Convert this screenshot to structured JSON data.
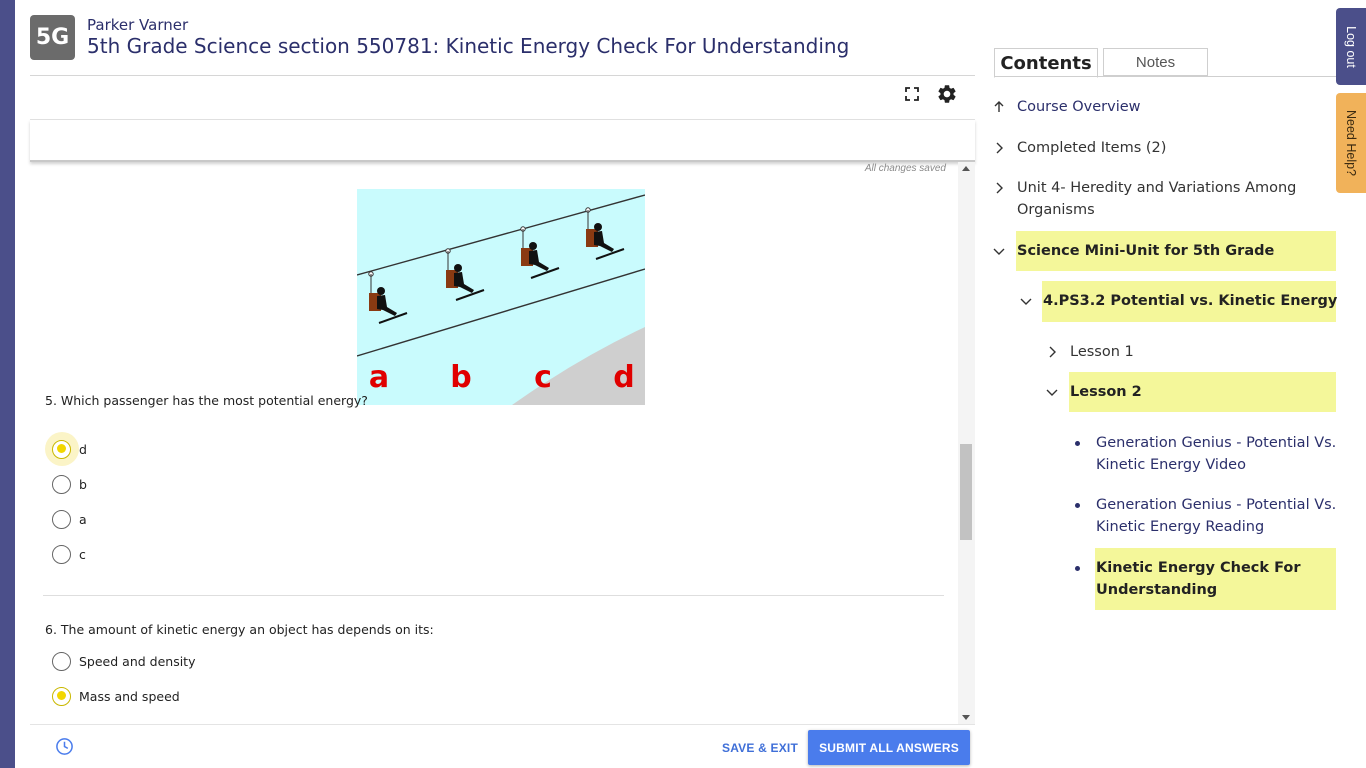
{
  "header": {
    "badge": "5G",
    "student_name": "Parker Varner",
    "title": "5th Grade Science section 550781: Kinetic Energy Check For Understanding"
  },
  "content": {
    "saved_status": "All changes saved",
    "questions": [
      {
        "text": "5. Which passenger has the most potential energy?",
        "image_letters": [
          "a",
          "b",
          "c",
          "d"
        ],
        "choices": [
          {
            "label": "d",
            "selected": true
          },
          {
            "label": "b",
            "selected": false
          },
          {
            "label": "a",
            "selected": false
          },
          {
            "label": "c",
            "selected": false
          }
        ]
      },
      {
        "text": "6. The amount of kinetic energy an object has depends on its:",
        "choices": [
          {
            "label": "Speed and density",
            "selected": false
          },
          {
            "label": "Mass and speed",
            "selected": true
          }
        ]
      }
    ]
  },
  "footer": {
    "save_exit": "SAVE & EXIT",
    "submit": "SUBMIT ALL ANSWERS"
  },
  "sidebar": {
    "tabs": [
      "Contents",
      "Notes"
    ],
    "active_tab": "Contents",
    "toc": {
      "course_overview": "Course Overview",
      "completed_items": "Completed Items (2)",
      "unit4_line1": "Unit 4- Heredity and Variations Among",
      "unit4_line2": "Organisms",
      "science_mini_unit": "Science Mini-Unit for 5th Grade",
      "ps32": "4.PS3.2 Potential vs. Kinetic Energy",
      "lesson1": "Lesson 1",
      "lesson2": "Lesson 2",
      "item1_line1": "Generation Genius - Potential Vs.",
      "item1_line2": "Kinetic Energy Video",
      "item2_line1": "Generation Genius - Potential Vs.",
      "item2_line2": "Kinetic Energy Reading",
      "item3_line1": "Kinetic Energy Check For",
      "item3_line2": "Understanding"
    }
  },
  "side_tabs": {
    "logout": "Log out",
    "need_help": "Need Help?"
  },
  "colors": {
    "rail": "#4b4f8a",
    "highlight": "#f4f79a",
    "accent_blue": "#4a7cec",
    "radio_selected": "#f2d600",
    "need_help": "#f1b25a"
  }
}
